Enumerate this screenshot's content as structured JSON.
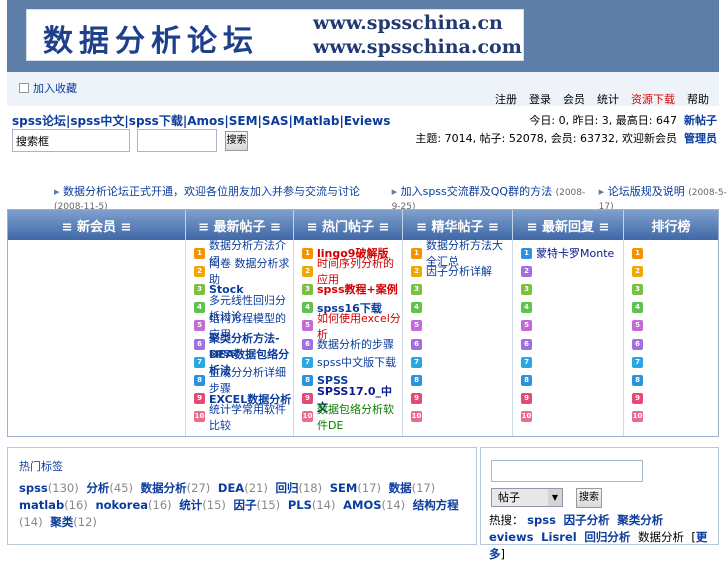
{
  "banner": {
    "logo_cn": "数据分析论坛",
    "url1": "www.spsschina.cn",
    "url2": "www.spsschina.com"
  },
  "subbar": {
    "fav_label": "加入收藏",
    "topnav": [
      "注册",
      "登录",
      "会员",
      "统计",
      "资源下载",
      "帮助"
    ]
  },
  "header": {
    "links": "spss论坛|spss中文|spss下载|Amos|SEM|SAS|Matlab|Eviews",
    "search_value": "搜索框",
    "go_label": "搜索",
    "stats1_label": "今日: 0, 昨日: 3, 最高日: 647",
    "stats1_link": "新帖子",
    "stats2_label": "主题: 7014, 帖子: 52078, 会员: 63732, 欢迎新会员",
    "stats2_link": "管理员"
  },
  "news": [
    {
      "text": "数据分析论坛正式开通，欢迎各位朋友加入并参与交流与讨论",
      "date": "(2008-11-5)"
    },
    {
      "text": "加入spss交流群及QQ群的方法",
      "date": "(2008-9-25)"
    },
    {
      "text": "论坛版规及说明",
      "date": "(2008-5-17)"
    }
  ],
  "board": {
    "headers": [
      "≡ 新会员 ≡",
      "≡ 最新帖子 ≡",
      "≡ 热门帖子 ≡",
      "≡ 精华帖子 ≡",
      "≡ 最新回复 ≡",
      "排行榜"
    ],
    "col2": [
      "数据分析方法介绍",
      "问卷 数据分析求助",
      "Stock",
      "多元线性回归分析讨论",
      "结构方程模型的应用",
      "聚类分析方法-spss",
      "DEA数据包络分析法",
      "主成分分析详细步骤",
      "EXCEL数据分析",
      "统计学常用软件比较"
    ],
    "col3": [
      "lingo9破解版",
      "时间序列分析的应用",
      "spss教程+案例",
      "spss16下载",
      "如何使用excel分析",
      "数据分析的步骤",
      "spss中文版下载",
      "SPSS",
      "SPSS17.0_中文",
      "数据包络分析软件DE"
    ],
    "col4": [
      "数据分析方法大全汇总",
      "因子分析详解"
    ],
    "col5": [
      "蒙特卡罗Monte"
    ]
  },
  "tags": {
    "title": "热门标签",
    "items": [
      {
        "name": "spss",
        "count": "(130)"
      },
      {
        "name": "分析",
        "count": "(45)"
      },
      {
        "name": "数据分析",
        "count": "(27)"
      },
      {
        "name": "DEA",
        "count": "(21)"
      },
      {
        "name": "回归",
        "count": "(18)"
      },
      {
        "name": "SEM",
        "count": "(17)"
      },
      {
        "name": "数据",
        "count": "(17)"
      },
      {
        "name": "matlab",
        "count": "(16)"
      },
      {
        "name": "nokorea",
        "count": "(16)"
      },
      {
        "name": "统计",
        "count": "(15)"
      },
      {
        "name": "因子",
        "count": "(15)"
      },
      {
        "name": "PLS",
        "count": "(14)"
      },
      {
        "name": "AMOS",
        "count": "(14)"
      },
      {
        "name": "结构方程",
        "count": "(14)"
      },
      {
        "name": "聚类",
        "count": "(12)"
      }
    ]
  },
  "side_search": {
    "select_value": "帖子",
    "go_label": "搜索",
    "hot_label": "热搜：",
    "hot_items": [
      "spss",
      "因子分析",
      "聚类分析",
      "eviews",
      "Lisrel",
      "回归分析"
    ],
    "hot_trailing": "数据分析",
    "more_label": "更多"
  }
}
